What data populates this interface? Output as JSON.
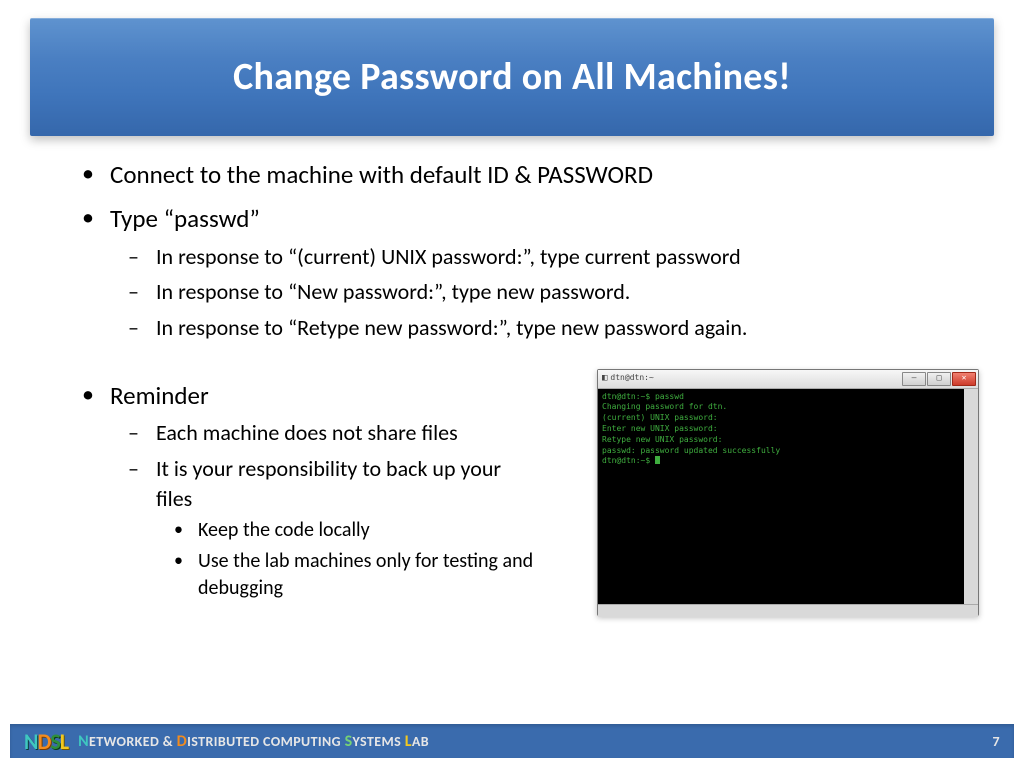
{
  "title": "Change Password on All Machines!",
  "bullets": {
    "b1": "Connect to the machine with default ID & PASSWORD",
    "b2": "Type “passwd”",
    "b2_subs": {
      "s1": "In response to “(current) UNIX password:”, type current password",
      "s2": "In response to “New password:”, type new password.",
      "s3": "In response to “Retype new password:”, type new password again."
    },
    "b3": "Reminder",
    "b3_subs": {
      "s1": "Each machine does not share files",
      "s2": "It is your responsibility to back up your files",
      "s2_subs": {
        "t1": "Keep the code locally",
        "t2": "Use the lab machines only for testing and debugging"
      }
    }
  },
  "terminal": {
    "title": "dtn@dtn:~",
    "lines": {
      "l1": "dtn@dtn:~$ passwd",
      "l2": "Changing password for dtn.",
      "l3": "(current) UNIX password:",
      "l4": "Enter new UNIX password:",
      "l5": "Retype new UNIX password:",
      "l6": "passwd: password updated successfully",
      "l7": "dtn@dtn:~$ "
    }
  },
  "footer": {
    "logo": {
      "c1": "N",
      "c2": "D",
      "c3": "S",
      "c4": "L"
    },
    "text": {
      "n": "N",
      "etworked": "ETWORKED & ",
      "d": "D",
      "istributed": "ISTRIBUTED COMPUTING ",
      "s": "S",
      "ystems": "YSTEMS ",
      "l": "L",
      "ab": "AB"
    },
    "page": "7"
  }
}
